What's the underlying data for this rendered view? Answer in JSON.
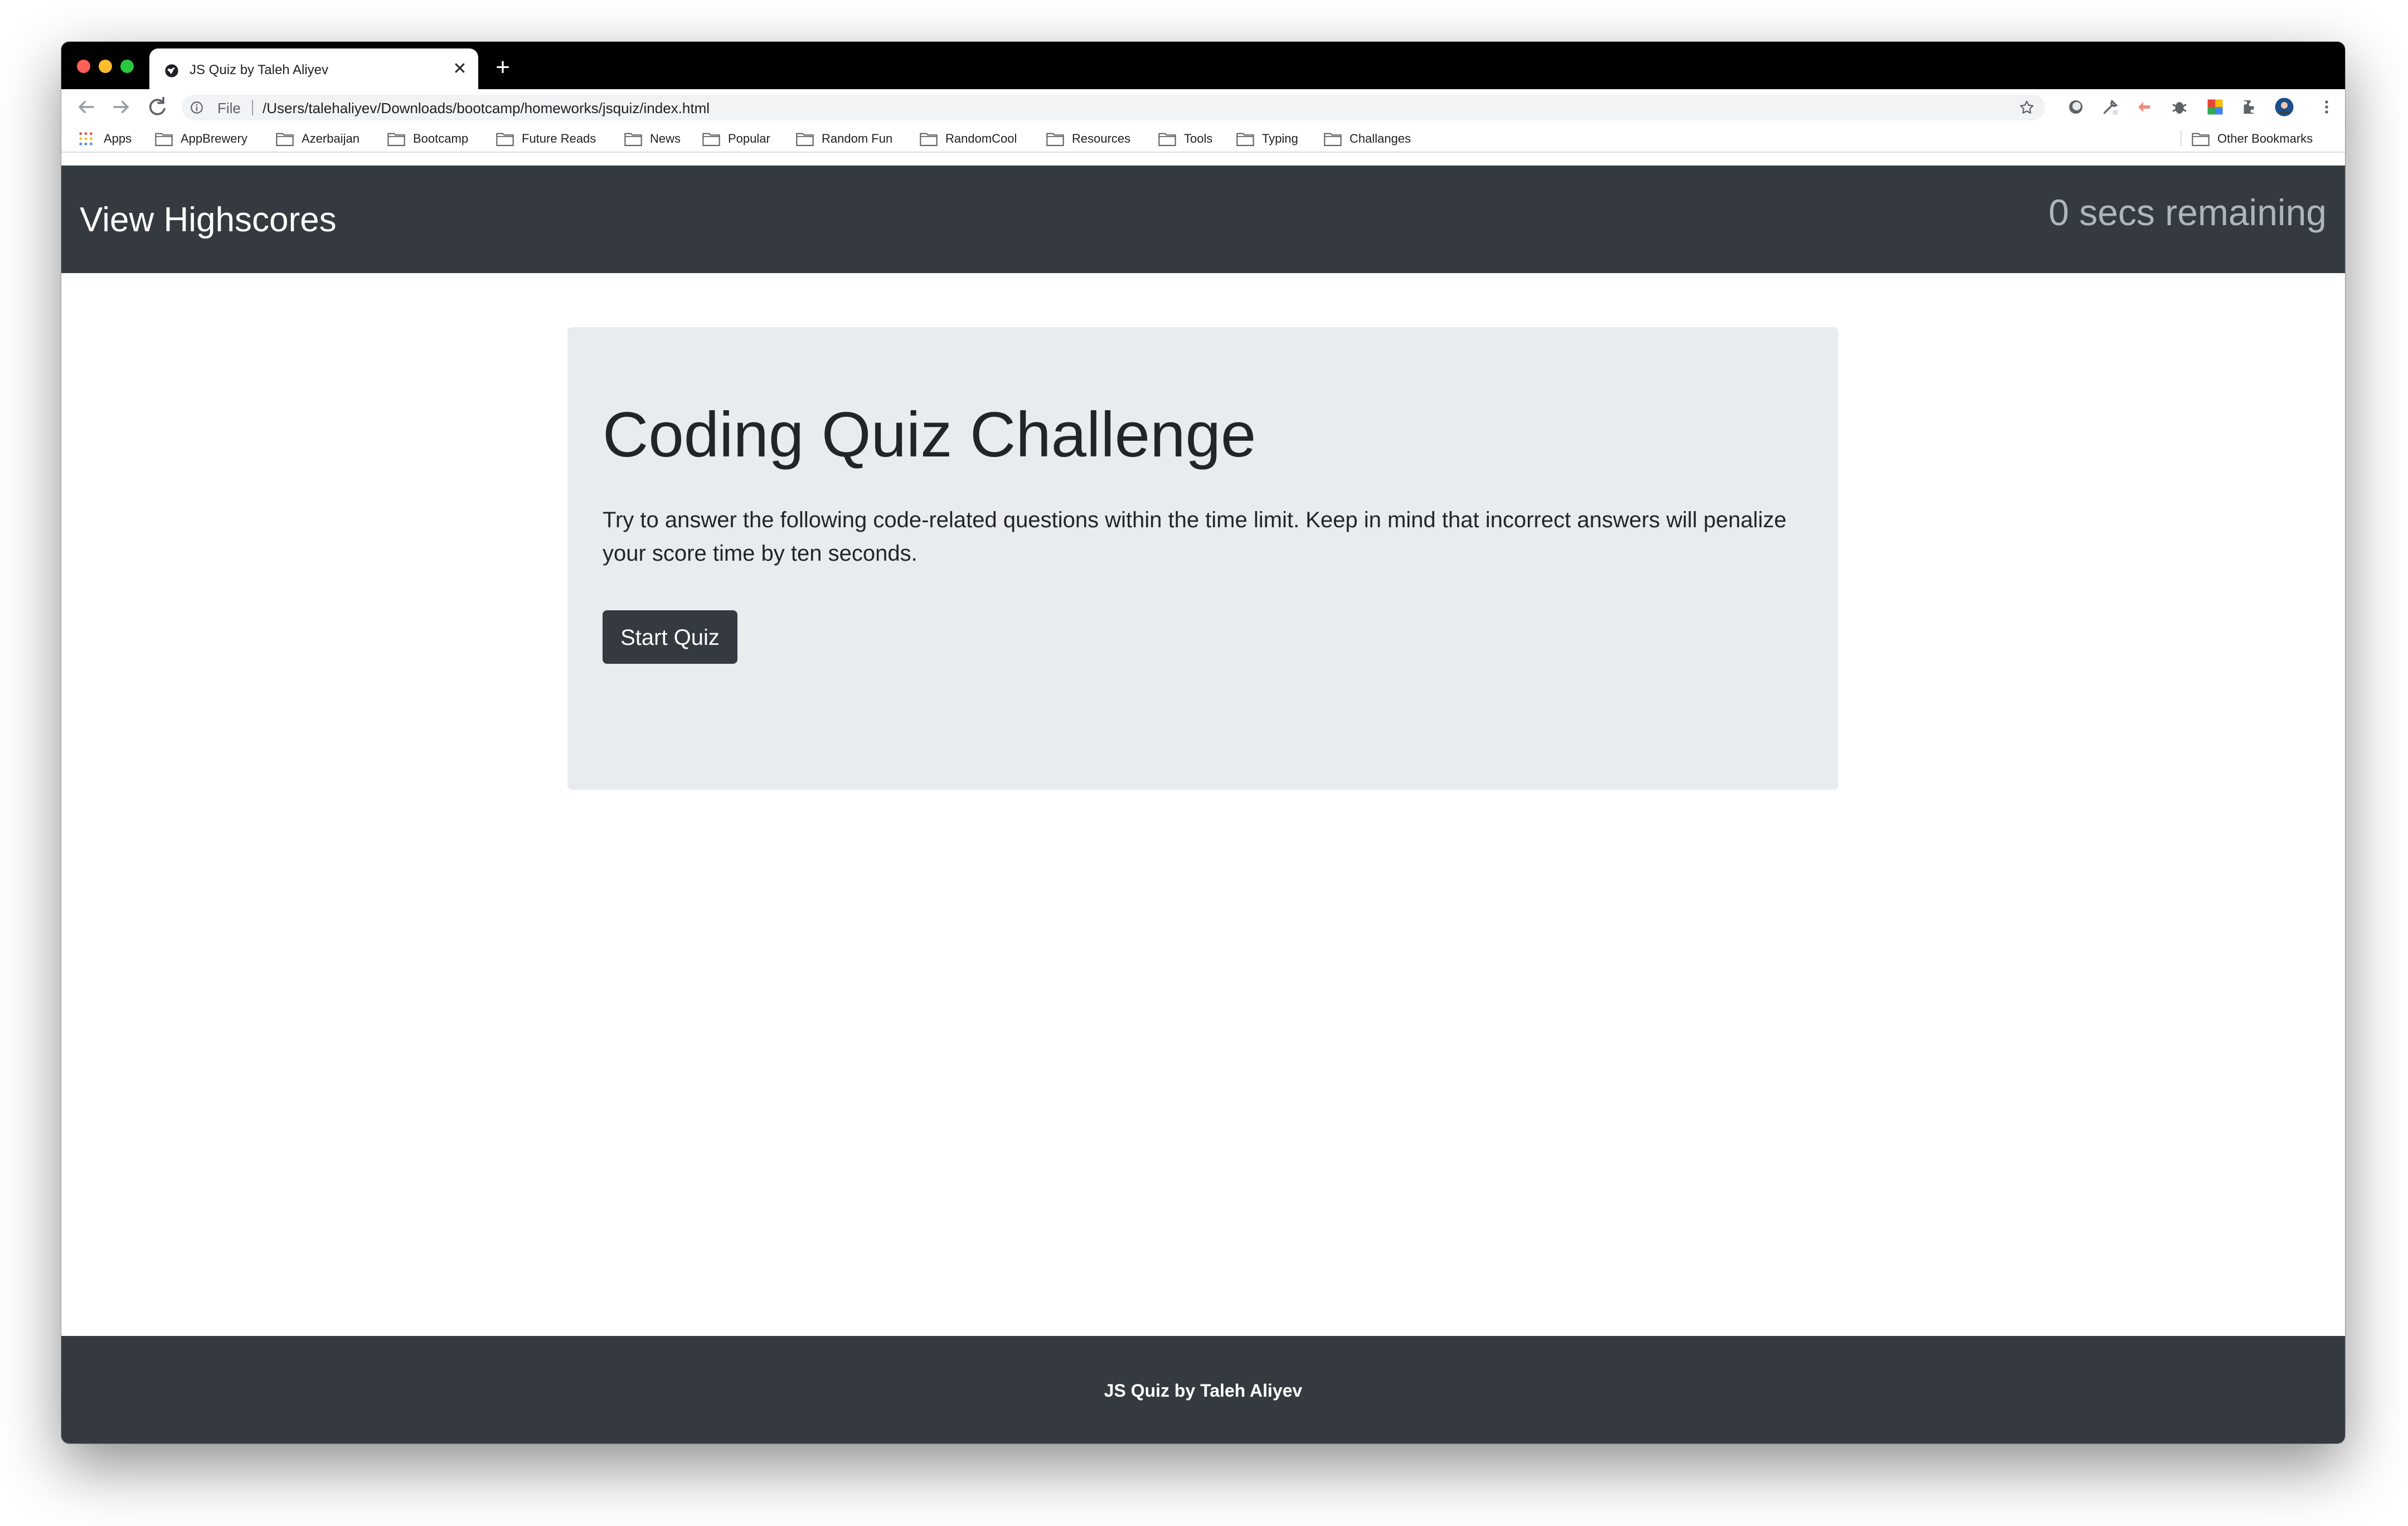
{
  "browser": {
    "tab_title": "JS Quiz by Taleh Aliyev",
    "new_tab_symbol": "+",
    "close_symbol": "✕",
    "url_scheme_label": "File",
    "url": "/Users/talehaliyev/Downloads/bootcamp/homeworks/jsquiz/index.html",
    "bookmarks": [
      "Apps",
      "AppBrewery",
      "Azerbaijan",
      "Bootcamp",
      "Future Reads",
      "News",
      "Popular",
      "Random Fun",
      "RandomCool",
      "Resources",
      "Tools",
      "Typing",
      "Challanges"
    ],
    "other_bookmarks": "Other Bookmarks"
  },
  "header": {
    "highscores_link": "View Highscores",
    "timer_text": "0 secs remaining"
  },
  "main": {
    "title": "Coding Quiz Challenge",
    "description": "Try to answer the following code-related questions within the time limit. Keep in mind that incorrect answers will penalize your score time by ten seconds.",
    "start_button": "Start Quiz"
  },
  "footer": {
    "text": "JS Quiz by Taleh Aliyev"
  },
  "colors": {
    "header_bg": "#343a40",
    "jumbotron_bg": "#e9ecef",
    "timer_text": "#adb5bd",
    "button_bg": "#343a40"
  }
}
